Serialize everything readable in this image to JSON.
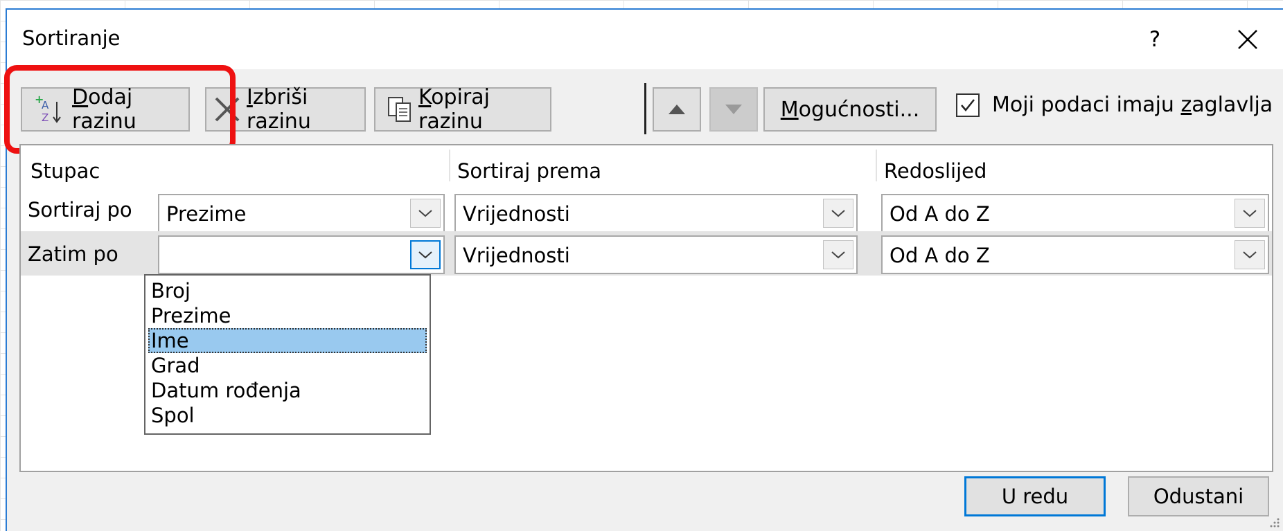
{
  "dialog": {
    "title": "Sortiranje",
    "help_label": "?"
  },
  "toolbar": {
    "add_level": {
      "pre": "",
      "accel": "D",
      "post": "odaj razinu"
    },
    "delete_level": {
      "pre": "",
      "accel": "I",
      "post": "zbriši razinu"
    },
    "copy_level": {
      "pre": "",
      "accel": "K",
      "post": "opiraj razinu"
    },
    "options": {
      "pre": "",
      "accel": "M",
      "post": "ogućnosti..."
    },
    "headers_checkbox": {
      "pre": "Moji podaci imaju ",
      "accel": "z",
      "post": "aglavlja",
      "checked": true
    }
  },
  "grid": {
    "headers": [
      "Stupac",
      "Sortiraj prema",
      "Redoslijed"
    ],
    "rows": [
      {
        "label": "Sortiraj po",
        "column": "Prezime",
        "sort_on": "Vrijednosti",
        "order": "Od A do Z"
      },
      {
        "label": "Zatim po",
        "column": "",
        "sort_on": "Vrijednosti",
        "order": "Od A do Z"
      }
    ]
  },
  "dropdown": {
    "options": [
      "Broj",
      "Prezime",
      "Ime",
      "Grad",
      "Datum rođenja",
      "Spol"
    ],
    "selected_index": 2
  },
  "footer": {
    "ok_label": "U redu",
    "cancel_label": "Odustani"
  },
  "colors": {
    "accent": "#0078d7",
    "highlight_ring": "#ee1111",
    "selected_option": "#99c9ef"
  }
}
